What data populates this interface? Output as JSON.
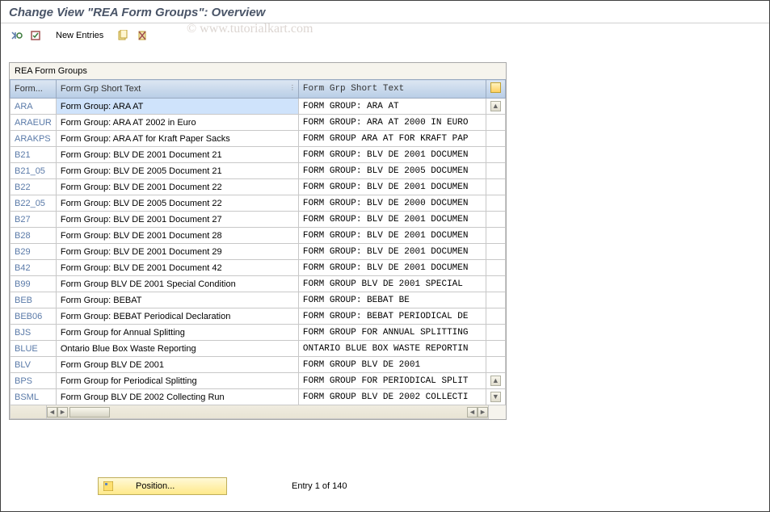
{
  "title": "Change View \"REA Form Groups\": Overview",
  "watermark": "© www.tutorialkart.com",
  "toolbar": {
    "new_entries": "New Entries"
  },
  "table": {
    "title": "REA Form Groups",
    "columns": {
      "code": "Form...",
      "txt1": "Form Grp Short Text",
      "txt2": "Form Grp Short Text"
    },
    "rows": [
      {
        "code": "ARA",
        "t1": "Form Group: ARA AT",
        "t2": "FORM GROUP: ARA AT",
        "sel": true
      },
      {
        "code": "ARAEUR",
        "t1": "Form Group: ARA AT 2002 in Euro",
        "t2": "FORM GROUP: ARA AT 2000 IN EURO"
      },
      {
        "code": "ARAKPS",
        "t1": "Form Group: ARA AT for Kraft Paper Sacks",
        "t2": "FORM GROUP ARA AT FOR KRAFT PAP"
      },
      {
        "code": "B21",
        "t1": "Form Group: BLV DE 2001 Document 21",
        "t2": "FORM GROUP: BLV DE 2001 DOCUMEN"
      },
      {
        "code": "B21_05",
        "t1": "Form Group: BLV DE 2005 Document 21",
        "t2": "FORM GROUP: BLV DE 2005 DOCUMEN"
      },
      {
        "code": "B22",
        "t1": "Form Group: BLV DE 2001 Document 22",
        "t2": "FORM GROUP: BLV DE 2001 DOCUMEN"
      },
      {
        "code": "B22_05",
        "t1": "Form Group: BLV  DE 2005 Document 22",
        "t2": "FORM GROUP: BLV DE 2000 DOCUMEN"
      },
      {
        "code": "B27",
        "t1": "Form Group: BLV DE 2001 Document 27",
        "t2": "FORM GROUP: BLV DE 2001 DOCUMEN"
      },
      {
        "code": "B28",
        "t1": "Form Group: BLV DE 2001 Document 28",
        "t2": "FORM GROUP: BLV DE 2001 DOCUMEN"
      },
      {
        "code": "B29",
        "t1": "Form Group: BLV DE 2001 Document 29",
        "t2": "FORM GROUP: BLV DE 2001 DOCUMEN"
      },
      {
        "code": "B42",
        "t1": "Form Group: BLV DE 2001 Document 42",
        "t2": "FORM GROUP: BLV DE 2001 DOCUMEN"
      },
      {
        "code": "B99",
        "t1": "Form Group BLV DE 2001 Special Condition",
        "t2": "FORM GROUP BLV DE 2001 SPECIAL"
      },
      {
        "code": "BEB",
        "t1": "Form Group: BEBAT",
        "t2": "FORM GROUP: BEBAT BE"
      },
      {
        "code": "BEB06",
        "t1": "Form Group: BEBAT Periodical Declaration",
        "t2": "FORM GROUP: BEBAT PERIODICAL DE"
      },
      {
        "code": "BJS",
        "t1": "Form Group for Annual Splitting",
        "t2": "FORM GROUP FOR ANNUAL SPLITTING"
      },
      {
        "code": "BLUE",
        "t1": "Ontario Blue Box Waste Reporting",
        "t2": "ONTARIO BLUE BOX WASTE REPORTIN"
      },
      {
        "code": "BLV",
        "t1": "Form Group BLV DE 2001",
        "t2": "FORM GROUP BLV DE 2001"
      },
      {
        "code": "BPS",
        "t1": "Form Group for Periodical Splitting",
        "t2": "FORM GROUP FOR PERIODICAL SPLIT"
      },
      {
        "code": "BSML",
        "t1": "Form Group BLV DE 2002 Collecting Run",
        "t2": "FORM GROUP BLV DE 2002 COLLECTI"
      }
    ]
  },
  "footer": {
    "position_label": "Position...",
    "entry_text": "Entry 1 of 140"
  }
}
